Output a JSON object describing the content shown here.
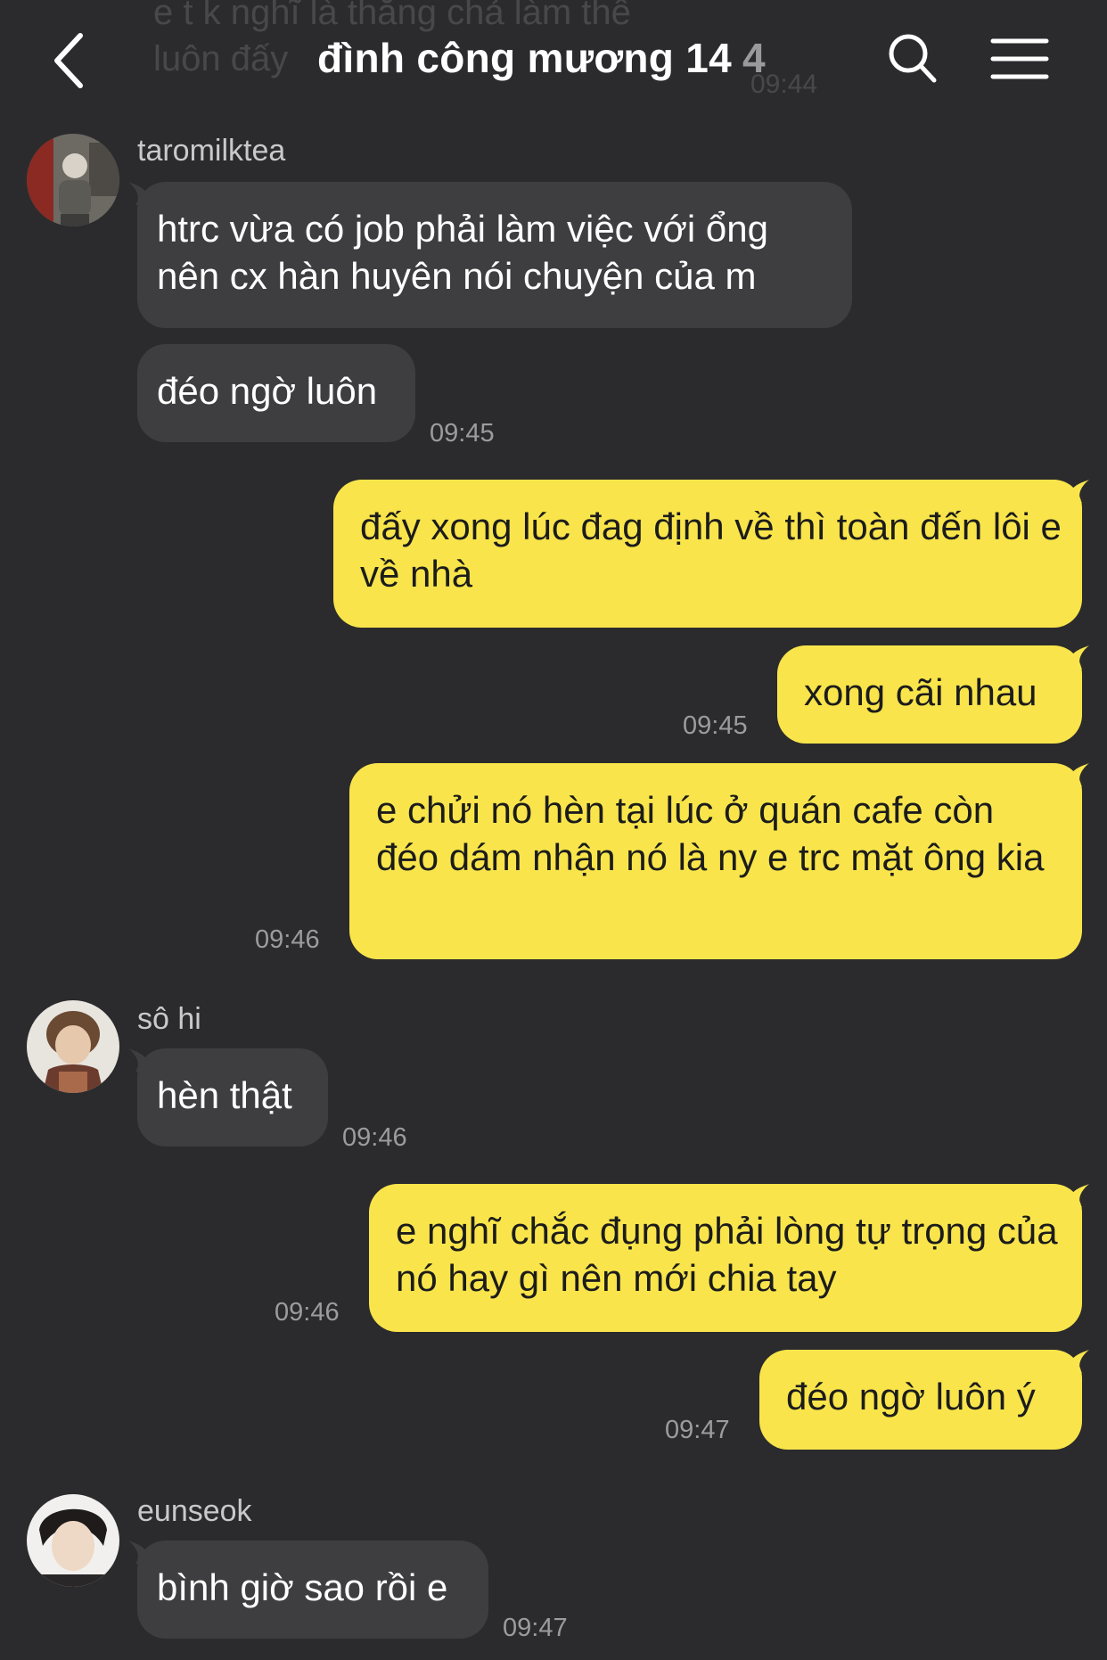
{
  "background_color": "#2b2b2d",
  "ghost": {
    "text": "e t k nghĩ là thằng chả làm thế\nluôn đấy",
    "time": "09:44"
  },
  "header": {
    "title": "đình công mương 14",
    "member_count": "4",
    "back_icon": "chevron-left-icon",
    "search_icon": "search-icon",
    "menu_icon": "hamburger-menu-icon"
  },
  "colors": {
    "incoming_bubble": "#3e3e40",
    "outgoing_bubble": "#f9e54b",
    "timestamp": "#9c9c9c"
  },
  "messages": [
    {
      "sender": "taromilktea",
      "text": "htrc vừa có job phải làm việc với ổng nên cx hàn huyên nói chuyện của m"
    },
    {
      "text": "đéo ngờ luôn",
      "time": "09:45"
    },
    {
      "text": "đấy xong lúc đag định về thì toàn đến lôi e về nhà"
    },
    {
      "text": "xong cãi nhau",
      "time": "09:45"
    },
    {
      "text": "e chửi nó hèn tại lúc ở quán cafe còn đéo dám nhận nó là ny e trc mặt ông kia",
      "time": "09:46"
    },
    {
      "sender": "sô hi",
      "text": "hèn thật",
      "time": "09:46"
    },
    {
      "text": "e nghĩ chắc đụng phải lòng tự trọng của nó hay gì nên mới chia tay",
      "time": "09:46"
    },
    {
      "text": "đéo ngờ luôn ý",
      "time": "09:47"
    },
    {
      "sender": "eunseok",
      "text": "bình giờ sao rồi e",
      "time": "09:47"
    }
  ]
}
